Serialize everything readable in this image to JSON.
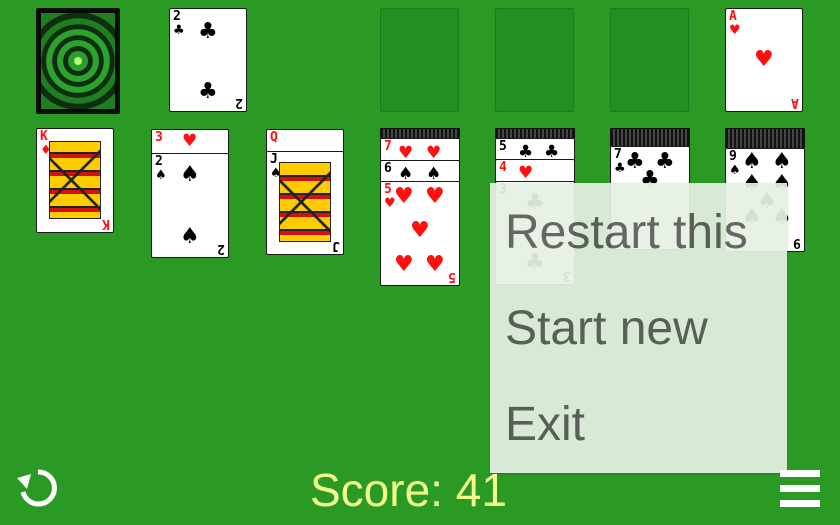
{
  "game": {
    "score_label": "Score:",
    "score_value": "41",
    "menu": {
      "items": [
        {
          "label": "Restart this"
        },
        {
          "label": "Start new"
        },
        {
          "label": "Exit"
        }
      ]
    },
    "stock": {
      "icon": "card-back-pattern"
    },
    "waste": {
      "rank": "2",
      "suit": "♣",
      "color": "black"
    },
    "foundations": [
      {
        "empty": true
      },
      {
        "empty": true
      },
      {
        "empty": true
      },
      {
        "rank": "A",
        "suit": "♥",
        "color": "red"
      }
    ],
    "tableau": [
      {
        "cards": [
          {
            "rank": "K",
            "suit": "♦",
            "color": "red",
            "face": true
          }
        ]
      },
      {
        "cards": [
          {
            "rank": "3",
            "suit": "♥",
            "color": "red"
          },
          {
            "rank": "2",
            "suit": "♠",
            "color": "black"
          }
        ]
      },
      {
        "cards": [
          {
            "rank": "Q",
            "suit": "♥",
            "color": "red"
          },
          {
            "rank": "J",
            "suit": "♠",
            "color": "black",
            "face": true
          }
        ]
      },
      {
        "cards": [
          {
            "rank": "7",
            "suit": "♥",
            "color": "red"
          },
          {
            "rank": "6",
            "suit": "♠",
            "color": "black"
          },
          {
            "rank": "5",
            "suit": "♥",
            "color": "red"
          }
        ]
      },
      {
        "cards": [
          {
            "rank": "5",
            "suit": "♣",
            "color": "black"
          },
          {
            "rank": "4",
            "suit": "♥",
            "color": "red"
          },
          {
            "rank": "3",
            "suit": "♣",
            "color": "black"
          }
        ]
      },
      {
        "cards": [
          {
            "rank": "7",
            "suit": "♣",
            "color": "black"
          }
        ]
      },
      {
        "cards": [
          {
            "rank": "9",
            "suit": "♠",
            "color": "black"
          }
        ]
      }
    ],
    "colors": {
      "felt": "#2a9a25",
      "foundation_slot": "#218f22",
      "score_text": "#f3ff8c",
      "menu_bg": "#e6f1e3",
      "menu_text": "#5b5b5b",
      "red_suit": "#ff1010"
    },
    "icons": {
      "restart": "restart-icon",
      "menu": "hamburger-menu-icon"
    }
  }
}
